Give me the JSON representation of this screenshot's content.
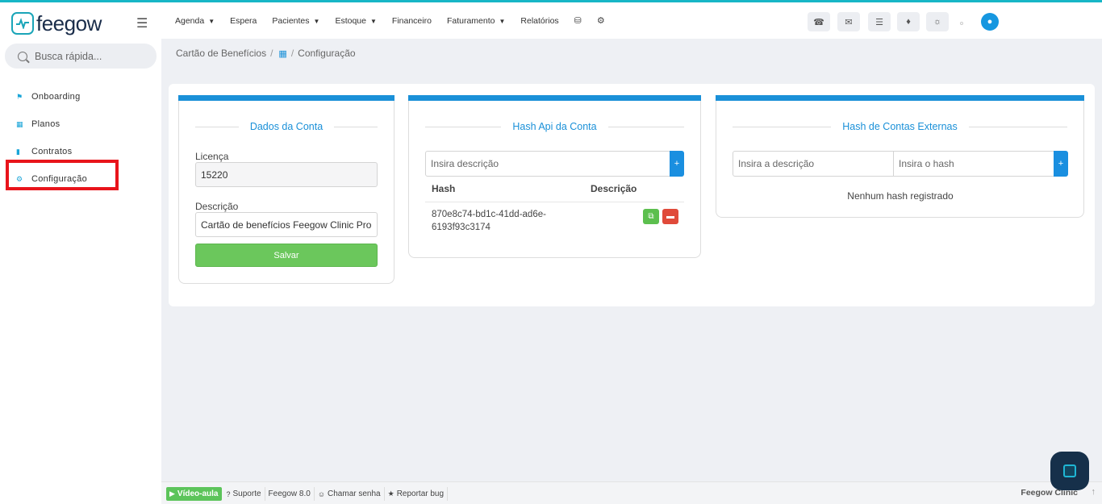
{
  "brand": {
    "name": "feegow"
  },
  "search": {
    "placeholder": "Busca rápida..."
  },
  "sidebar": {
    "items": [
      {
        "label": "Onboarding",
        "icon": "home-icon"
      },
      {
        "label": "Planos",
        "icon": "table-icon"
      },
      {
        "label": "Contratos",
        "icon": "file-icon"
      },
      {
        "label": "Configuração",
        "icon": "gear-icon"
      }
    ]
  },
  "topnav": {
    "items": [
      {
        "label": "Agenda",
        "dropdown": true
      },
      {
        "label": "Espera",
        "dropdown": false
      },
      {
        "label": "Pacientes",
        "dropdown": true
      },
      {
        "label": "Estoque",
        "dropdown": true
      },
      {
        "label": "Financeiro",
        "dropdown": false
      },
      {
        "label": "Faturamento",
        "dropdown": true
      },
      {
        "label": "Relatórios",
        "dropdown": false
      }
    ],
    "tools": [
      "phone-icon",
      "inbox-icon",
      "tasks-icon",
      "bell-icon",
      "chat-icon"
    ]
  },
  "breadcrumb": {
    "root": "Cartão de Benefícios",
    "current": "Configuração"
  },
  "conta": {
    "title": "Dados da Conta",
    "licenca_label": "Licença",
    "licenca_value": "15220",
    "descricao_label": "Descrição",
    "descricao_value": "Cartão de benefícios Feegow Clinic Pro",
    "save_label": "Salvar"
  },
  "hash_api": {
    "title": "Hash Api da Conta",
    "input_placeholder": "Insira descrição",
    "add_label": "+",
    "col_hash": "Hash",
    "col_descricao": "Descrição",
    "rows": [
      {
        "hash": "870e8c74-bd1c-41dd-ad6e-6193f93c3174",
        "descricao": ""
      }
    ]
  },
  "hash_externas": {
    "title": "Hash de Contas Externas",
    "desc_placeholder": "Insira a descrição",
    "hash_placeholder": "Insira o hash",
    "add_label": "+",
    "empty_text": "Nenhum hash registrado"
  },
  "footer": {
    "video": "Vídeo-aula",
    "suporte": "Suporte",
    "version": "Feegow 8.0",
    "chamar": "Chamar senha",
    "bug": "Reportar bug",
    "brand": "Feegow Clinic"
  },
  "colors": {
    "accent": "#1a90d8",
    "success": "#6bc75c",
    "danger": "#e04a3a",
    "highlight": "#e8141b"
  }
}
